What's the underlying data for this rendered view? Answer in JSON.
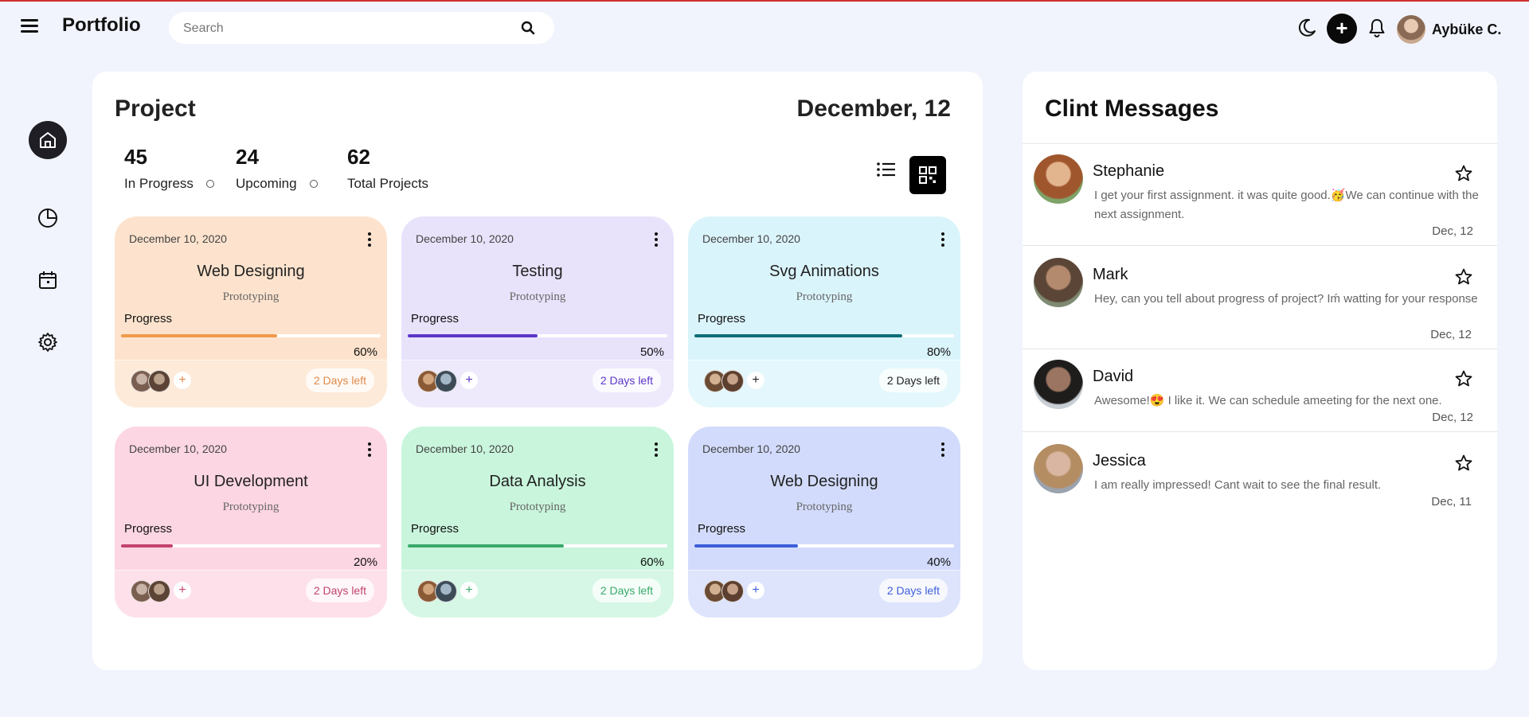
{
  "header": {
    "logo": "Portfolio",
    "search_placeholder": "Search",
    "user_name": "Aybüke C."
  },
  "sidebar": {
    "items": [
      {
        "icon": "home-icon",
        "active": true
      },
      {
        "icon": "pie-chart-icon",
        "active": false
      },
      {
        "icon": "calendar-icon",
        "active": false
      },
      {
        "icon": "gear-icon",
        "active": false
      }
    ]
  },
  "projects": {
    "title": "Project",
    "date": "December, 12",
    "stats": [
      {
        "value": "45",
        "label": "In Progress"
      },
      {
        "value": "24",
        "label": "Upcoming"
      },
      {
        "value": "62",
        "label": "Total Projects"
      }
    ],
    "cards": [
      {
        "date": "December 10, 2020",
        "title": "Web Designing",
        "subtitle": "Prototyping",
        "progress_label": "Progress",
        "progress": 60,
        "progress_text": "60%",
        "days_left": "2 Days left",
        "bg": "#fde3cd",
        "accent": "#ef9a4a",
        "days_color": "#e0894a"
      },
      {
        "date": "December 10, 2020",
        "title": "Testing",
        "subtitle": "Prototyping",
        "progress_label": "Progress",
        "progress": 50,
        "progress_text": "50%",
        "days_left": "2 Days left",
        "bg": "#e8e3fb",
        "accent": "#5b36c7",
        "days_color": "#5b36c7"
      },
      {
        "date": "December 10, 2020",
        "title": "Svg Animations",
        "subtitle": "Prototyping",
        "progress_label": "Progress",
        "progress": 80,
        "progress_text": "80%",
        "days_left": "2 Days left",
        "bg": "#daf4fb",
        "accent": "#0e6e78",
        "days_color": "#222222"
      },
      {
        "date": "December 10, 2020",
        "title": "UI Development",
        "subtitle": "Prototyping",
        "progress_label": "Progress",
        "progress": 20,
        "progress_text": "20%",
        "days_left": "2 Days left",
        "bg": "#fdd6e3",
        "accent": "#c2436f",
        "days_color": "#c2436f"
      },
      {
        "date": "December 10, 2020",
        "title": "Data Analysis",
        "subtitle": "Prototyping",
        "progress_label": "Progress",
        "progress": 60,
        "progress_text": "60%",
        "days_left": "2 Days left",
        "bg": "#c9f5dc",
        "accent": "#3aaa6a",
        "days_color": "#3aaa6a"
      },
      {
        "date": "December 10, 2020",
        "title": "Web Designing",
        "subtitle": "Prototyping",
        "progress_label": "Progress",
        "progress": 40,
        "progress_text": "40%",
        "days_left": "2 Days left",
        "bg": "#d2dbfb",
        "accent": "#3c5fd8",
        "days_color": "#3c5fd8"
      }
    ]
  },
  "messages": {
    "title": "Clint Messages",
    "items": [
      {
        "name": "Stephanie",
        "text": "I get your first assignment. it was quite good.🥳We can continue with the next assignment.",
        "date": "Dec, 12"
      },
      {
        "name": "Mark",
        "text": "Hey, can you tell about progress of project? Iḿ watting for your response",
        "date": "Dec, 12"
      },
      {
        "name": "David",
        "text": "Awesome!😍 I like it. We can schedule ameeting for the next one.",
        "date": "Dec, 12"
      },
      {
        "name": "Jessica",
        "text": "I am really impressed! Cant wait to see the final result.",
        "date": "Dec, 11"
      }
    ]
  }
}
